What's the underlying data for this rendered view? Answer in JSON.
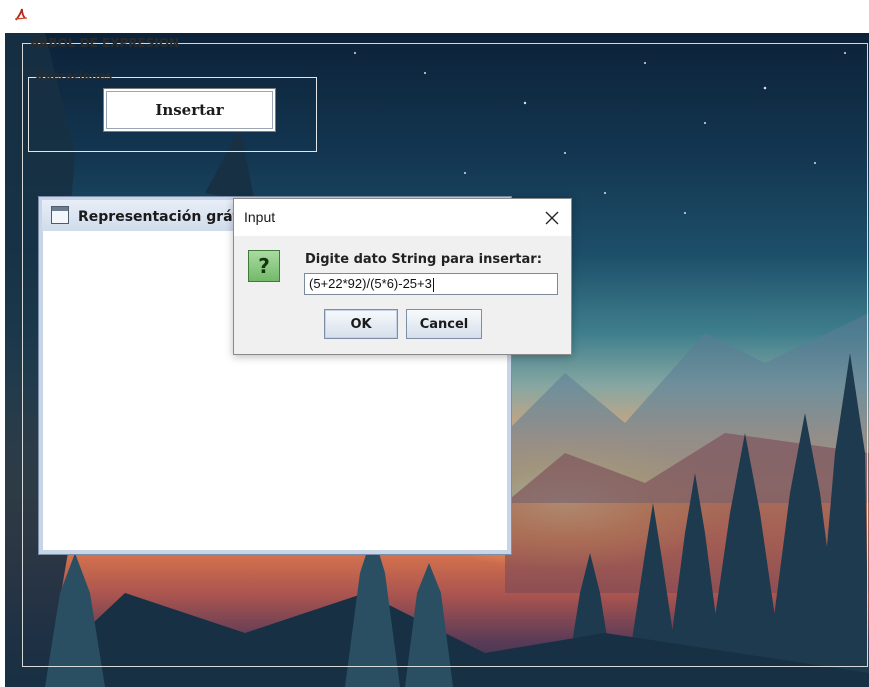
{
  "main_window": {
    "title": "",
    "group_title": "ARBOL DE EXPRESION",
    "operations": {
      "title": "Operaciones",
      "insert_button": "Insertar"
    }
  },
  "internal_frame": {
    "title": "Representación gráfica"
  },
  "dialog": {
    "title": "Input",
    "icon": "question-icon",
    "prompt": "Digite dato String para insertar:",
    "input_value": "(5+22*92)/(5*6)-25+3",
    "ok_label": "OK",
    "cancel_label": "Cancel"
  },
  "colors": {
    "dialog_bg": "#f0f0f0",
    "question_icon": "#73b96a",
    "button_border": "#7d8fa6"
  }
}
